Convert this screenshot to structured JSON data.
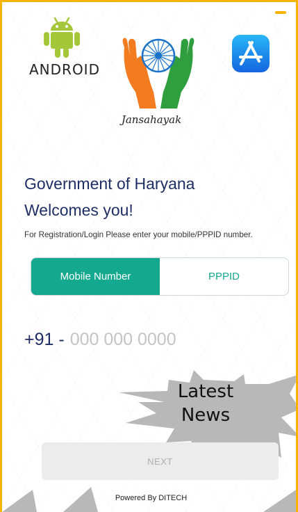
{
  "logos": {
    "android_wordmark": "ANDROID",
    "app_name": "Jansahayak",
    "appstore_icon": "appstore-icon"
  },
  "welcome": {
    "title_line1": "Government of Haryana",
    "title_line2": "Welcomes you!",
    "instruction": "For Registration/Login Please enter your mobile/PPPID number."
  },
  "login_mode": {
    "options": [
      "Mobile Number",
      "PPPID"
    ],
    "selected": "Mobile Number"
  },
  "phone": {
    "prefix": "+91 -",
    "placeholder": "000 000 0000",
    "value": ""
  },
  "news_badge": {
    "line1": "Latest",
    "line2": "News"
  },
  "next_button": "NEXT",
  "footer": "Powered By DITECH",
  "colors": {
    "accent": "#14a88f",
    "heading": "#1f2f66",
    "frame_border": "#f4b400",
    "android_green": "#a4c639",
    "saffron": "#f47c20",
    "green": "#2e9e3e",
    "chakra_blue": "#1a73c8",
    "appstore_blue": "#1e88f0",
    "news_gray": "#b8b8b8"
  }
}
